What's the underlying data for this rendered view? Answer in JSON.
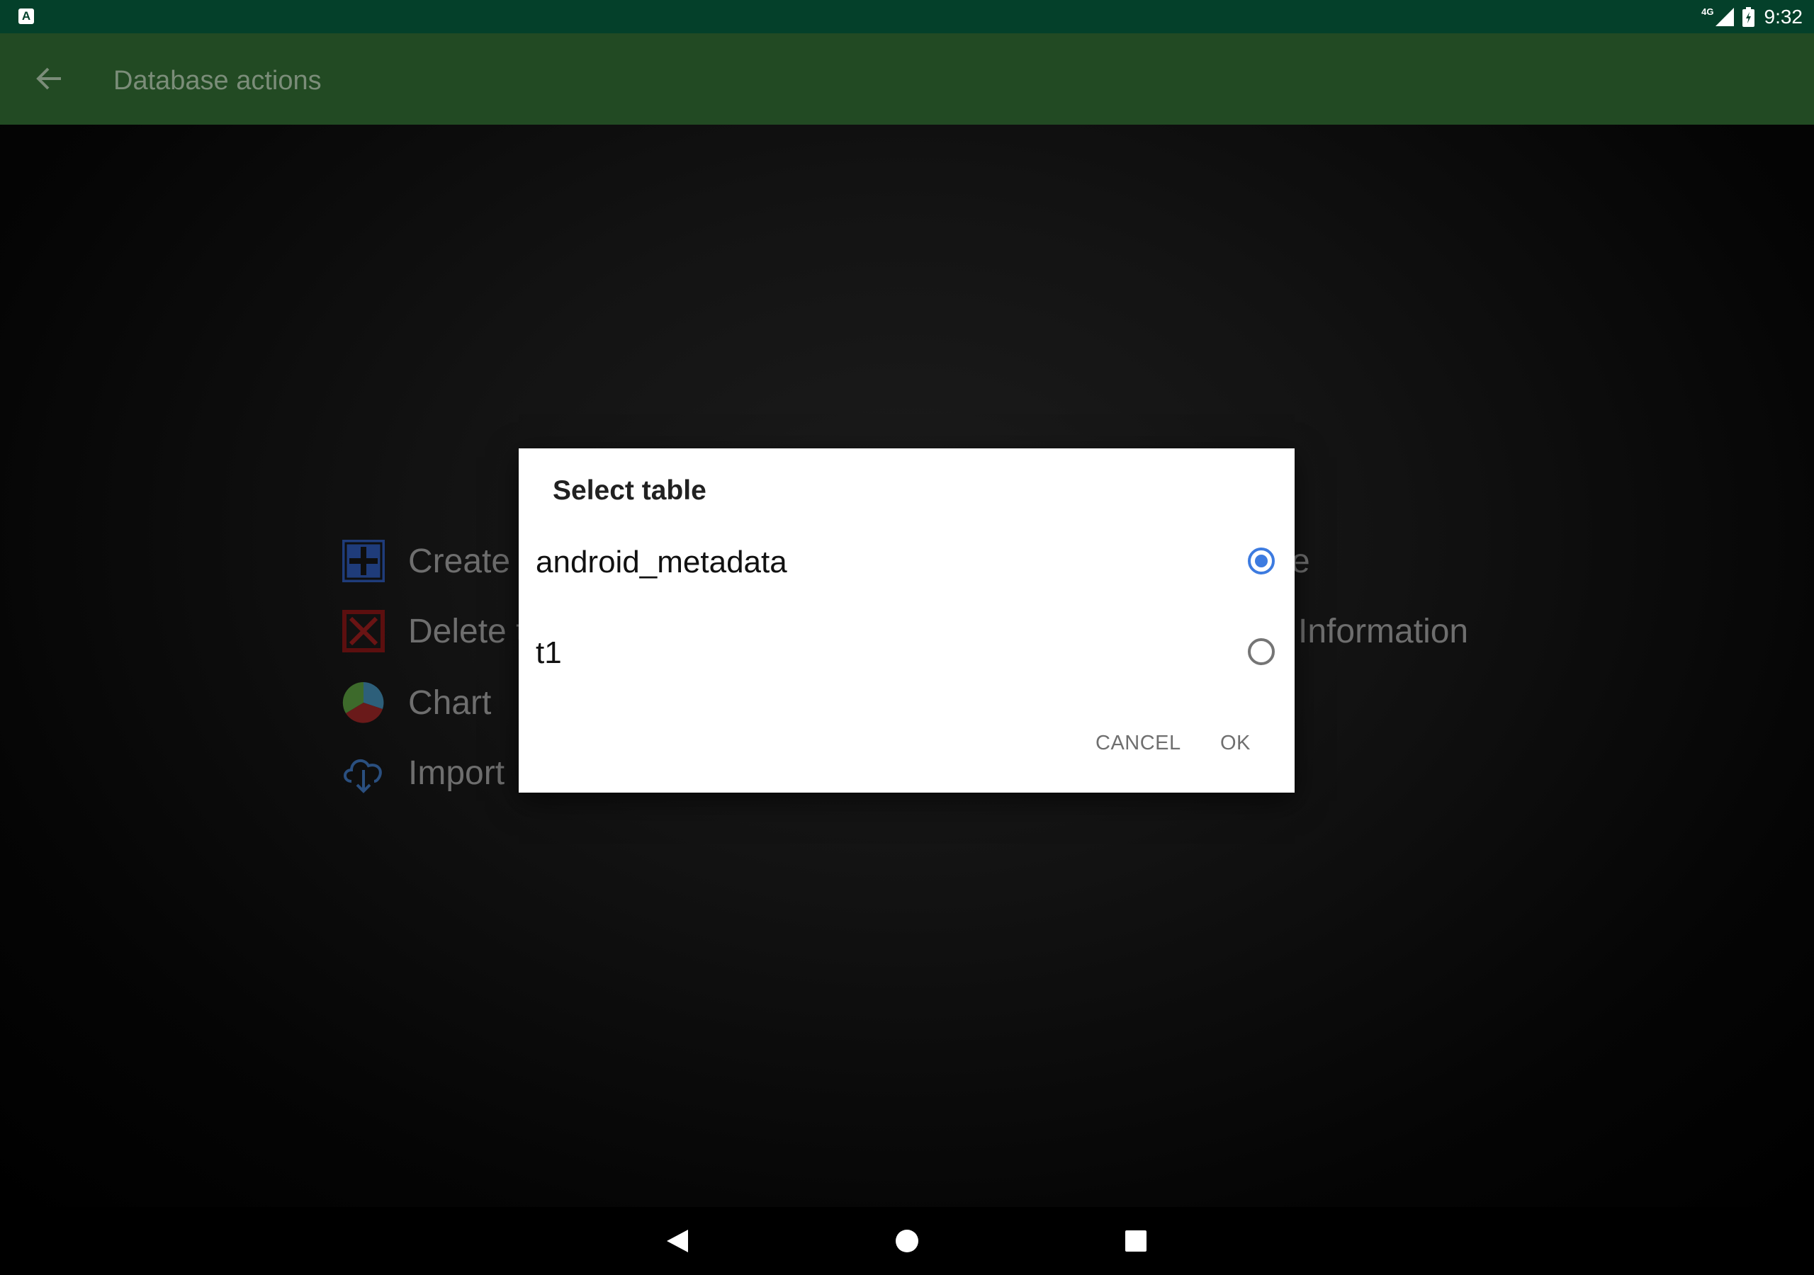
{
  "status_bar": {
    "time": "9:32",
    "network": "4G",
    "notification_icon": "A"
  },
  "app_bar": {
    "title": "Database actions"
  },
  "background_actions": [
    {
      "label": "Create t",
      "icon": "add-box-icon"
    },
    {
      "label": "Delete t",
      "icon": "delete-box-icon"
    },
    {
      "label": "Chart",
      "icon": "pie-chart-icon"
    },
    {
      "label": "Import",
      "icon": "cloud-download-icon"
    }
  ],
  "background_right": {
    "partial_label": "e",
    "information_label": "Information"
  },
  "dialog": {
    "title": "Select table",
    "options": [
      {
        "label": "android_metadata",
        "selected": true
      },
      {
        "label": "t1",
        "selected": false
      }
    ],
    "cancel_label": "CANCEL",
    "ok_label": "OK"
  },
  "colors": {
    "status_bar": "#04402a",
    "app_bar_dimmed": "#224a23",
    "radio_selected": "#3d7be0"
  }
}
